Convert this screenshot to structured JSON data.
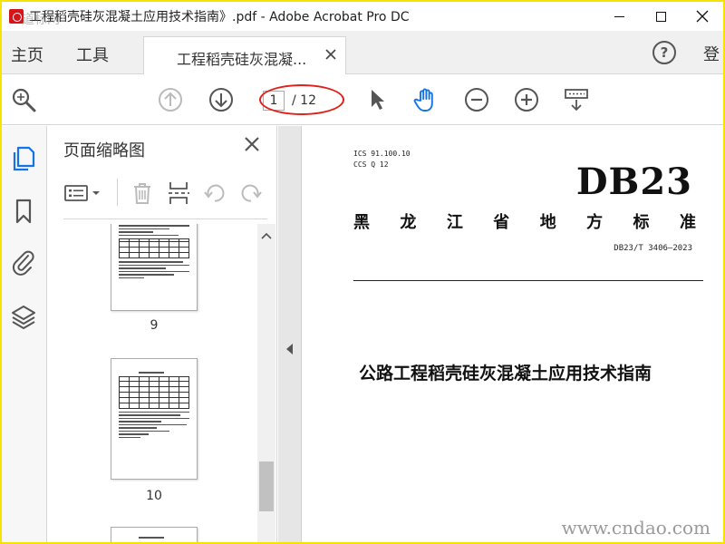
{
  "window": {
    "title": "工程稻壳硅灰混凝土应用技术指南》.pdf - Adobe Acrobat Pro DC",
    "title_watermark": "道标网"
  },
  "tabs": {
    "home": "主页",
    "tools": "工具",
    "document": "工程稻壳硅灰混凝...",
    "login": "登"
  },
  "toolbar": {
    "current_page": "1",
    "total_pages": "/ 12"
  },
  "thumbnails": {
    "title": "页面缩略图",
    "pages": [
      {
        "number": "9"
      },
      {
        "number": "10"
      }
    ]
  },
  "document": {
    "ics": "ICS 91.100.10",
    "ccs": "CCS Q 12",
    "standard_mark": "DB23",
    "province_chars": [
      "黑",
      "龙",
      "江",
      "省",
      "地",
      "方",
      "标",
      "准"
    ],
    "code": "DB23/T 3406—2023",
    "title": "公路工程稻壳硅灰混凝土应用技术指南"
  },
  "watermark": "www.cndao.com",
  "colors": {
    "accent_blue": "#1473e6",
    "highlight_red": "#e0201a",
    "icon_gray": "#555555",
    "disabled_gray": "#bbbbbb",
    "frame_yellow": "#f5e400"
  }
}
